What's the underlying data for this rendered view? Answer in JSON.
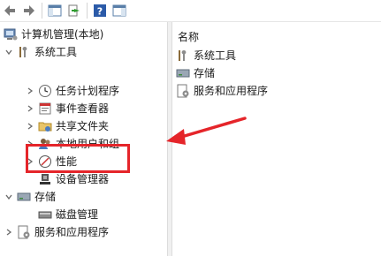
{
  "toolbar": {
    "buttons": [
      {
        "icon": "back-arrow-icon"
      },
      {
        "icon": "forward-arrow-icon"
      },
      {
        "icon": "show-console-tree-icon"
      },
      {
        "icon": "export-list-icon"
      },
      {
        "icon": "help-icon"
      },
      {
        "icon": "show-action-pane-icon"
      }
    ]
  },
  "tree": {
    "root_label": "计算机管理(本地)",
    "system_tools_label": "系统工具",
    "task_scheduler_label": "任务计划程序",
    "event_viewer_label": "事件查看器",
    "shared_folders_label": "共享文件夹",
    "local_users_label": "本地用户和组",
    "performance_label": "性能",
    "device_manager_label": "设备管理器",
    "storage_label": "存储",
    "disk_management_label": "磁盘管理",
    "services_label": "服务和应用程序"
  },
  "list": {
    "column_name": "名称",
    "items": [
      "系统工具",
      "存储",
      "服务和应用程序"
    ]
  },
  "colors": {
    "annotation": "#e5252a",
    "chevron": "#6b6b6b"
  }
}
